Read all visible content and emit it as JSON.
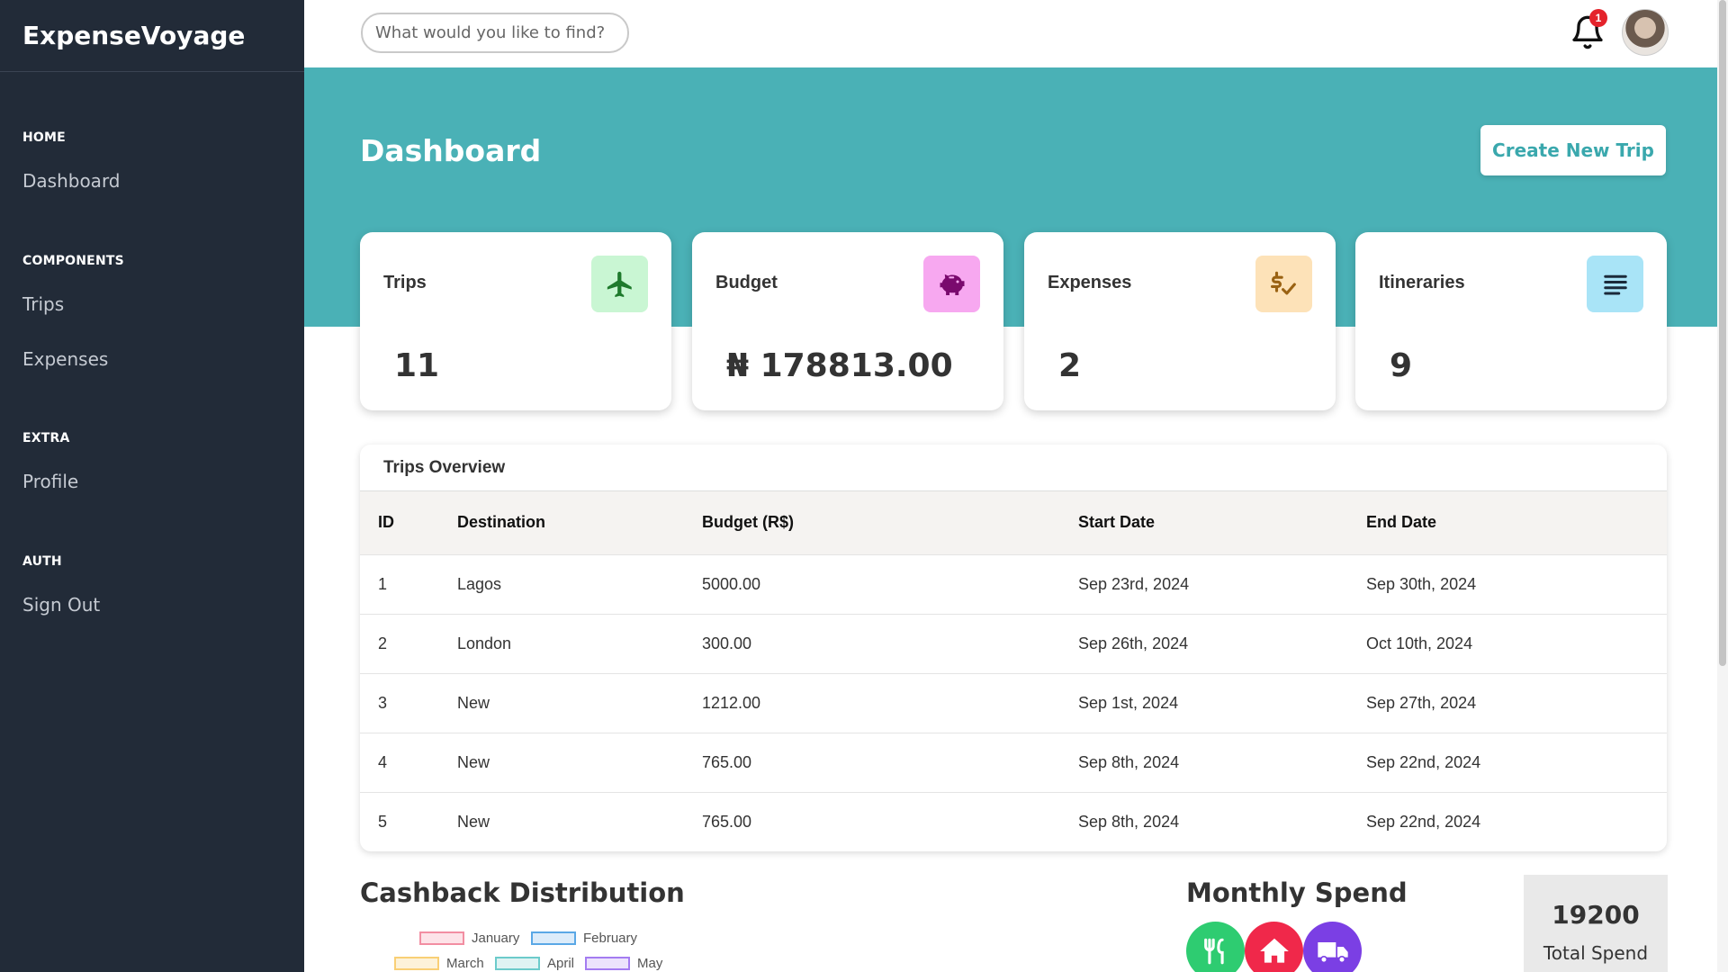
{
  "brand": "ExpenseVoyage",
  "search": {
    "placeholder": "What would you like to find?"
  },
  "notifications": {
    "count": "1"
  },
  "sidebar": {
    "sections": [
      {
        "heading": "HOME",
        "items": [
          "Dashboard"
        ]
      },
      {
        "heading": "COMPONENTS",
        "items": [
          "Trips",
          "Expenses"
        ]
      },
      {
        "heading": "EXTRA",
        "items": [
          "Profile"
        ]
      },
      {
        "heading": "AUTH",
        "items": [
          "Sign Out"
        ]
      }
    ]
  },
  "page": {
    "title": "Dashboard",
    "create_button": "Create New Trip"
  },
  "cards": [
    {
      "label": "Trips",
      "value": "11",
      "icon": "plane-icon",
      "icon_bg": "#c9f6d3",
      "icon_color": "#1e7a2c"
    },
    {
      "label": "Budget",
      "value": "₦ 178813.00",
      "icon": "piggy-bank-icon",
      "icon_bg": "#f7a8f0",
      "icon_color": "#7a0a6e"
    },
    {
      "label": "Expenses",
      "value": "2",
      "icon": "dollar-check-icon",
      "icon_bg": "#fde2b8",
      "icon_color": "#9a6212"
    },
    {
      "label": "Itineraries",
      "value": "9",
      "icon": "list-icon",
      "icon_bg": "#a9e4f7",
      "icon_color": "#1b2a3a"
    }
  ],
  "trips_overview": {
    "title": "Trips Overview",
    "columns": [
      "ID",
      "Destination",
      "Budget (R$)",
      "Start Date",
      "End Date"
    ],
    "rows": [
      [
        "1",
        "Lagos",
        "5000.00",
        "Sep 23rd, 2024",
        "Sep 30th, 2024"
      ],
      [
        "2",
        "London",
        "300.00",
        "Sep 26th, 2024",
        "Oct 10th, 2024"
      ],
      [
        "3",
        "New",
        "1212.00",
        "Sep 1st, 2024",
        "Sep 27th, 2024"
      ],
      [
        "4",
        "New",
        "765.00",
        "Sep 8th, 2024",
        "Sep 22nd, 2024"
      ],
      [
        "5",
        "New",
        "765.00",
        "Sep 8th, 2024",
        "Sep 22nd, 2024"
      ]
    ]
  },
  "cashback": {
    "title": "Cashback Distribution",
    "legend": [
      {
        "label": "January",
        "color": "#f28ea2",
        "fill": "#fde3e8"
      },
      {
        "label": "February",
        "color": "#5aa8e6",
        "fill": "#dcecfa"
      },
      {
        "label": "March",
        "color": "#f9cf75",
        "fill": "#fdf2d9"
      },
      {
        "label": "April",
        "color": "#6ccbcb",
        "fill": "#dff3f3"
      },
      {
        "label": "May",
        "color": "#a47cf1",
        "fill": "#ece3fc"
      }
    ]
  },
  "monthly_spend": {
    "title": "Monthly Spend",
    "icons": [
      {
        "name": "food-icon",
        "color": "#2ecc71"
      },
      {
        "name": "home-icon",
        "color": "#f0284a"
      },
      {
        "name": "truck-icon",
        "color": "#7b3fe4"
      }
    ],
    "total_value": "19200",
    "total_label": "Total Spend"
  },
  "colors": {
    "sidebar": "#222b38",
    "accent": "#4ab1b6"
  }
}
